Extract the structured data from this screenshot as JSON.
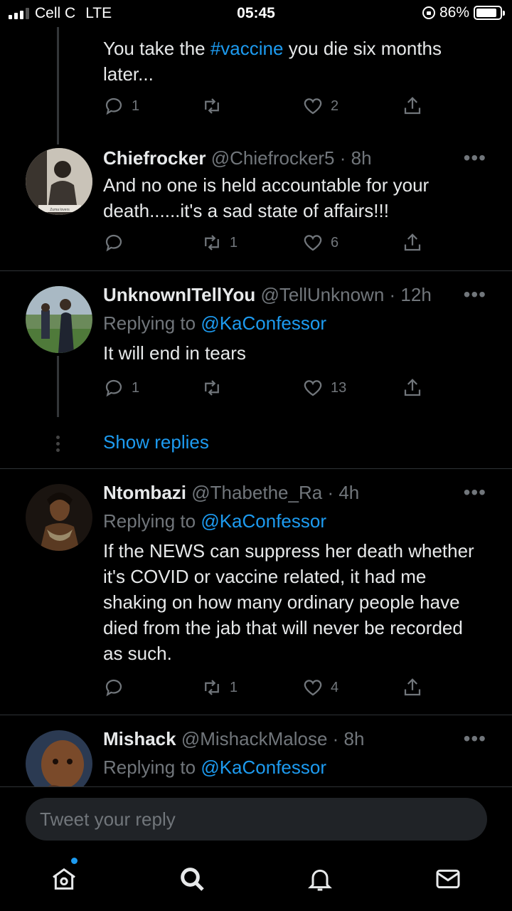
{
  "status_bar": {
    "carrier": "Cell C",
    "network": "LTE",
    "time": "05:45",
    "battery": "86%",
    "battery_level": 0.86
  },
  "top_tweet": {
    "text_before": "You take the ",
    "hashtag": "#vaccine",
    "text_after": " you die six months later...",
    "reply_count": "1",
    "retweet_count": "",
    "like_count": "2"
  },
  "tweets": [
    {
      "name": "Chiefrocker",
      "handle": "@Chiefrocker5",
      "time": "· 8h",
      "text": "And no one is held accountable for your death......it's a sad state of affairs!!!",
      "reply_count": "",
      "retweet_count": "1",
      "like_count": "6",
      "avatar_caption": "Zuma lovers"
    },
    {
      "name": "UnknownITellYou",
      "handle": "@TellUnknown",
      "time": "· 12h",
      "replying_prefix": "Replying to ",
      "replying_to": "@KaConfessor",
      "text": "It will end in tears",
      "reply_count": "1",
      "retweet_count": "",
      "like_count": "13"
    },
    {
      "name": "Ntombazi",
      "handle": "@Thabethe_Ra",
      "time": "· 4h",
      "replying_prefix": "Replying to ",
      "replying_to": "@KaConfessor",
      "text": "If the NEWS can suppress her death whether it's COVID or vaccine related, it had me shaking on how many ordinary people have died from the jab that will never be recorded as such.",
      "reply_count": "",
      "retweet_count": "1",
      "like_count": "4"
    },
    {
      "name": "Mishack",
      "handle": "@MishackMalose",
      "time": "· 8h",
      "replying_prefix": "Replying to ",
      "replying_to": "@KaConfessor"
    }
  ],
  "show_replies_label": "Show replies",
  "more_glyph": "•••",
  "reply_bar": {
    "placeholder": "Tweet your reply"
  },
  "tabs": [
    "home-icon",
    "search-icon",
    "notifications-icon",
    "messages-icon"
  ],
  "colors": {
    "accent": "#1d9bf0",
    "muted": "#71767b",
    "background": "#000000"
  }
}
